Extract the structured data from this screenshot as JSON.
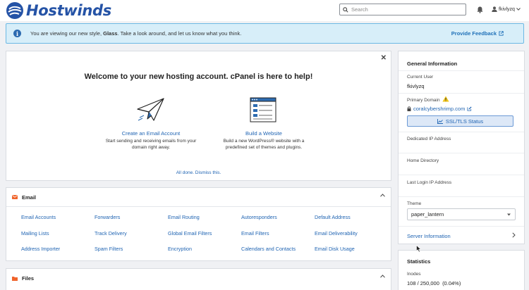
{
  "header": {
    "brand": "Hostwinds",
    "search_placeholder": "Search",
    "username": "fkivlyzq"
  },
  "notice": {
    "text_before": "You are viewing our new style, ",
    "text_bold": "Glass",
    "text_after": ". Take a look around, and let us know what you think.",
    "feedback_label": "Provide Feedback"
  },
  "welcome": {
    "title": "Welcome to your new hosting account. cPanel is here to help!",
    "tasks": [
      {
        "link": "Create an Email Account",
        "desc": "Start sending and receiving emails from your domain right away."
      },
      {
        "link": "Build a Website",
        "desc": "Build a new WordPress® website with a predefined set of themes and plugins."
      }
    ],
    "dismiss": "All done. Dismiss this."
  },
  "email": {
    "title": "Email",
    "links": [
      "Email Accounts",
      "Forwarders",
      "Email Routing",
      "Autoresponders",
      "Default Address",
      "Mailing Lists",
      "Track Delivery",
      "Global Email Filters",
      "Email Filters",
      "Email Deliverability",
      "Address Importer",
      "Spam Filters",
      "Encryption",
      "Calendars and Contacts",
      "Email Disk Usage"
    ]
  },
  "files": {
    "title": "Files"
  },
  "general_info": {
    "title": "General Information",
    "current_user_label": "Current User",
    "current_user": "fkivlyzq",
    "primary_domain_label": "Primary Domain",
    "primary_domain": "coralcybershrimp.com",
    "ssl_button": "SSL/TLS Status",
    "dedicated_ip_label": "Dedicated IP Address",
    "home_dir_label": "Home Directory",
    "last_login_label": "Last Login IP Address",
    "theme_label": "Theme",
    "theme_value": "paper_lantern",
    "server_info": "Server Information"
  },
  "statistics": {
    "title": "Statistics",
    "inodes_label": "Inodes",
    "inodes_value": "108 / 250,000",
    "inodes_percent": "(0.04%)"
  },
  "colors": {
    "brand_blue": "#2553a6",
    "link_blue": "#2165b3",
    "email_orange": "#f0642c",
    "warning_yellow": "#f0c419"
  }
}
